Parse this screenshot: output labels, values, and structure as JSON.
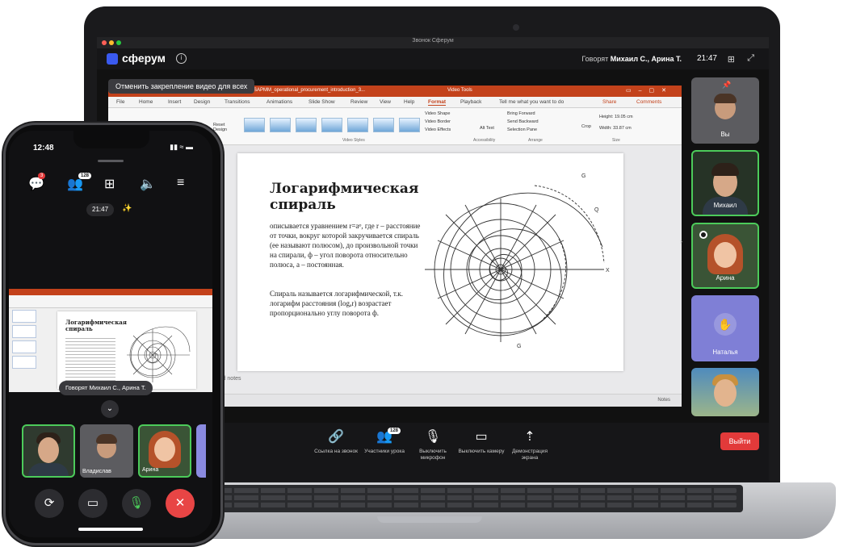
{
  "laptop": {
    "window_title": "Звонок Сферум",
    "app_name": "сферум",
    "speaking_prefix": "Говорят",
    "speaking_names": "Михаил С., Арина Т.",
    "time": "21:47",
    "unpin_tooltip": "Отменить закрепление видео для всех",
    "ppt": {
      "file_title": "SAPMM_operational_procurement_introduction_3...",
      "tools_label": "Video Tools",
      "menu": [
        "File",
        "Home",
        "Insert",
        "Design",
        "Transitions",
        "Animations",
        "Slide Show",
        "Review",
        "View",
        "Help",
        "Format",
        "Playback",
        "Tell me what you want to do",
        "Share",
        "Comments"
      ],
      "ribbon": {
        "reset_label": "Reset Design",
        "video_shape": "Video Shape",
        "video_border": "Video Border",
        "video_effects": "Video Effects",
        "alt_text": "Alt Text",
        "bring_forward": "Bring Forward",
        "send_backward": "Send Backward",
        "selection_pane": "Selection Pane",
        "crop": "Crop",
        "height": "Height: 19.05 cm",
        "width": "Width: 33.87 cm",
        "group_video_styles": "Video Styles",
        "group_accessibility": "Accessibility",
        "group_arrange": "Arrange",
        "group_size": "Size"
      },
      "slide": {
        "heading": "Логарифмическая спираль",
        "body": "описывается уравнением r=aᵠ, где r – расстояние от точки, вокруг которой закручивается спираль (ее называют полюсом), до произвольной точки на спирали, ф – угол поворота относительно полюса, а – постоянная.",
        "body2": "Спираль называется логарифмической, т.к. логарифм расстояния (logₐr) возрастает пропорционально углу поворота ф."
      },
      "notes_hint": "to add notes",
      "zoom": "Notes"
    },
    "participants": [
      {
        "name": "Вы",
        "kind": "self"
      },
      {
        "name": "Михаил",
        "kind": "video"
      },
      {
        "name": "Арина",
        "kind": "video"
      },
      {
        "name": "Наталья",
        "kind": "hand"
      },
      {
        "name": "",
        "kind": "video"
      }
    ],
    "toolbar": {
      "items": [
        {
          "label": "Ссылка на звонок",
          "icon": "link-icon"
        },
        {
          "label": "Участники урока",
          "icon": "participants-icon",
          "badge": "128"
        },
        {
          "label": "Выключить микрофон",
          "icon": "mic-icon"
        },
        {
          "label": "Выключить камеру",
          "icon": "camera-icon"
        },
        {
          "label": "Демонстрация экрана",
          "icon": "screen-share-icon"
        }
      ],
      "exit_label": "Выйти"
    }
  },
  "phone": {
    "status_time": "12:48",
    "chat_badge": "3",
    "participants_badge": "128",
    "call_time": "21:47",
    "speaking": "Говорят Михаил С., Арина Т.",
    "slide_title": "Логарифмическая спираль",
    "tiles": [
      {
        "name": "",
        "kind": "video"
      },
      {
        "name": "Владислав",
        "kind": "avatar"
      },
      {
        "name": "Арина",
        "kind": "video"
      }
    ]
  }
}
